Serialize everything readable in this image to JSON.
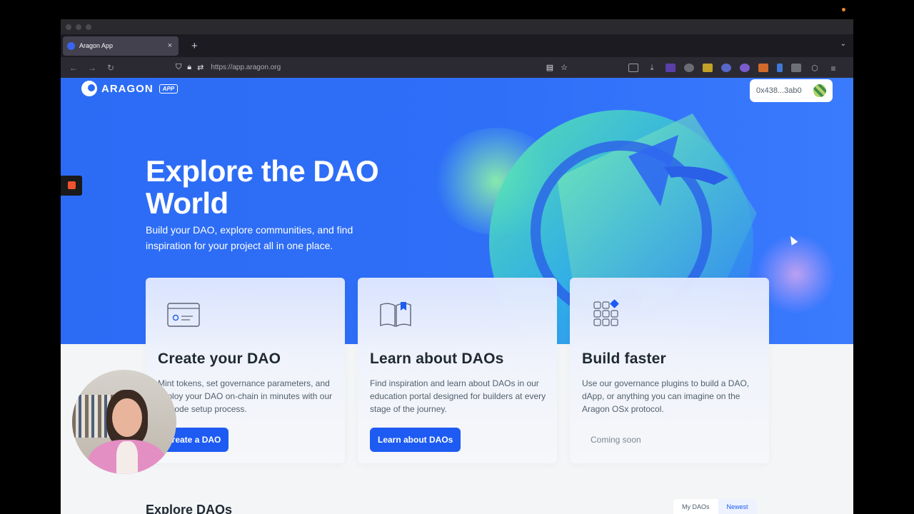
{
  "browser": {
    "tab_title": "Aragon App",
    "tab_close": "×",
    "new_tab": "+",
    "tab_list": "⌄",
    "url": "https://app.aragon.org",
    "back": "←",
    "forward": "→",
    "reload": "↻"
  },
  "header": {
    "logo_text": "ARAGON",
    "logo_badge": "APP",
    "wallet_address": "0x438...3ab0"
  },
  "hero": {
    "title": "Explore the DAO World",
    "subtitle": "Build your DAO, explore communities, and find inspiration for your project all in one place."
  },
  "cards": [
    {
      "title": "Create your DAO",
      "description": "Mint tokens, set governance parameters, and deploy your DAO on-chain in minutes with our no-code setup process.",
      "button": "Create a DAO"
    },
    {
      "title": "Learn about DAOs",
      "description": "Find inspiration and learn about DAOs in our education portal designed for builders at every stage of the journey.",
      "button": "Learn about DAOs"
    },
    {
      "title": "Build faster",
      "description": "Use our governance plugins to build a DAO, dApp, or anything you can imagine on the Aragon OSx protocol.",
      "button": "Coming soon"
    }
  ],
  "explore": {
    "title": "Explore DAOs",
    "filter_options": [
      "My DAOs",
      "Newest"
    ],
    "selected": "Newest"
  },
  "colors": {
    "brand_blue": "#2c6cf5",
    "button_blue": "#1d5bf2",
    "page_bg": "#f4f5f7"
  }
}
